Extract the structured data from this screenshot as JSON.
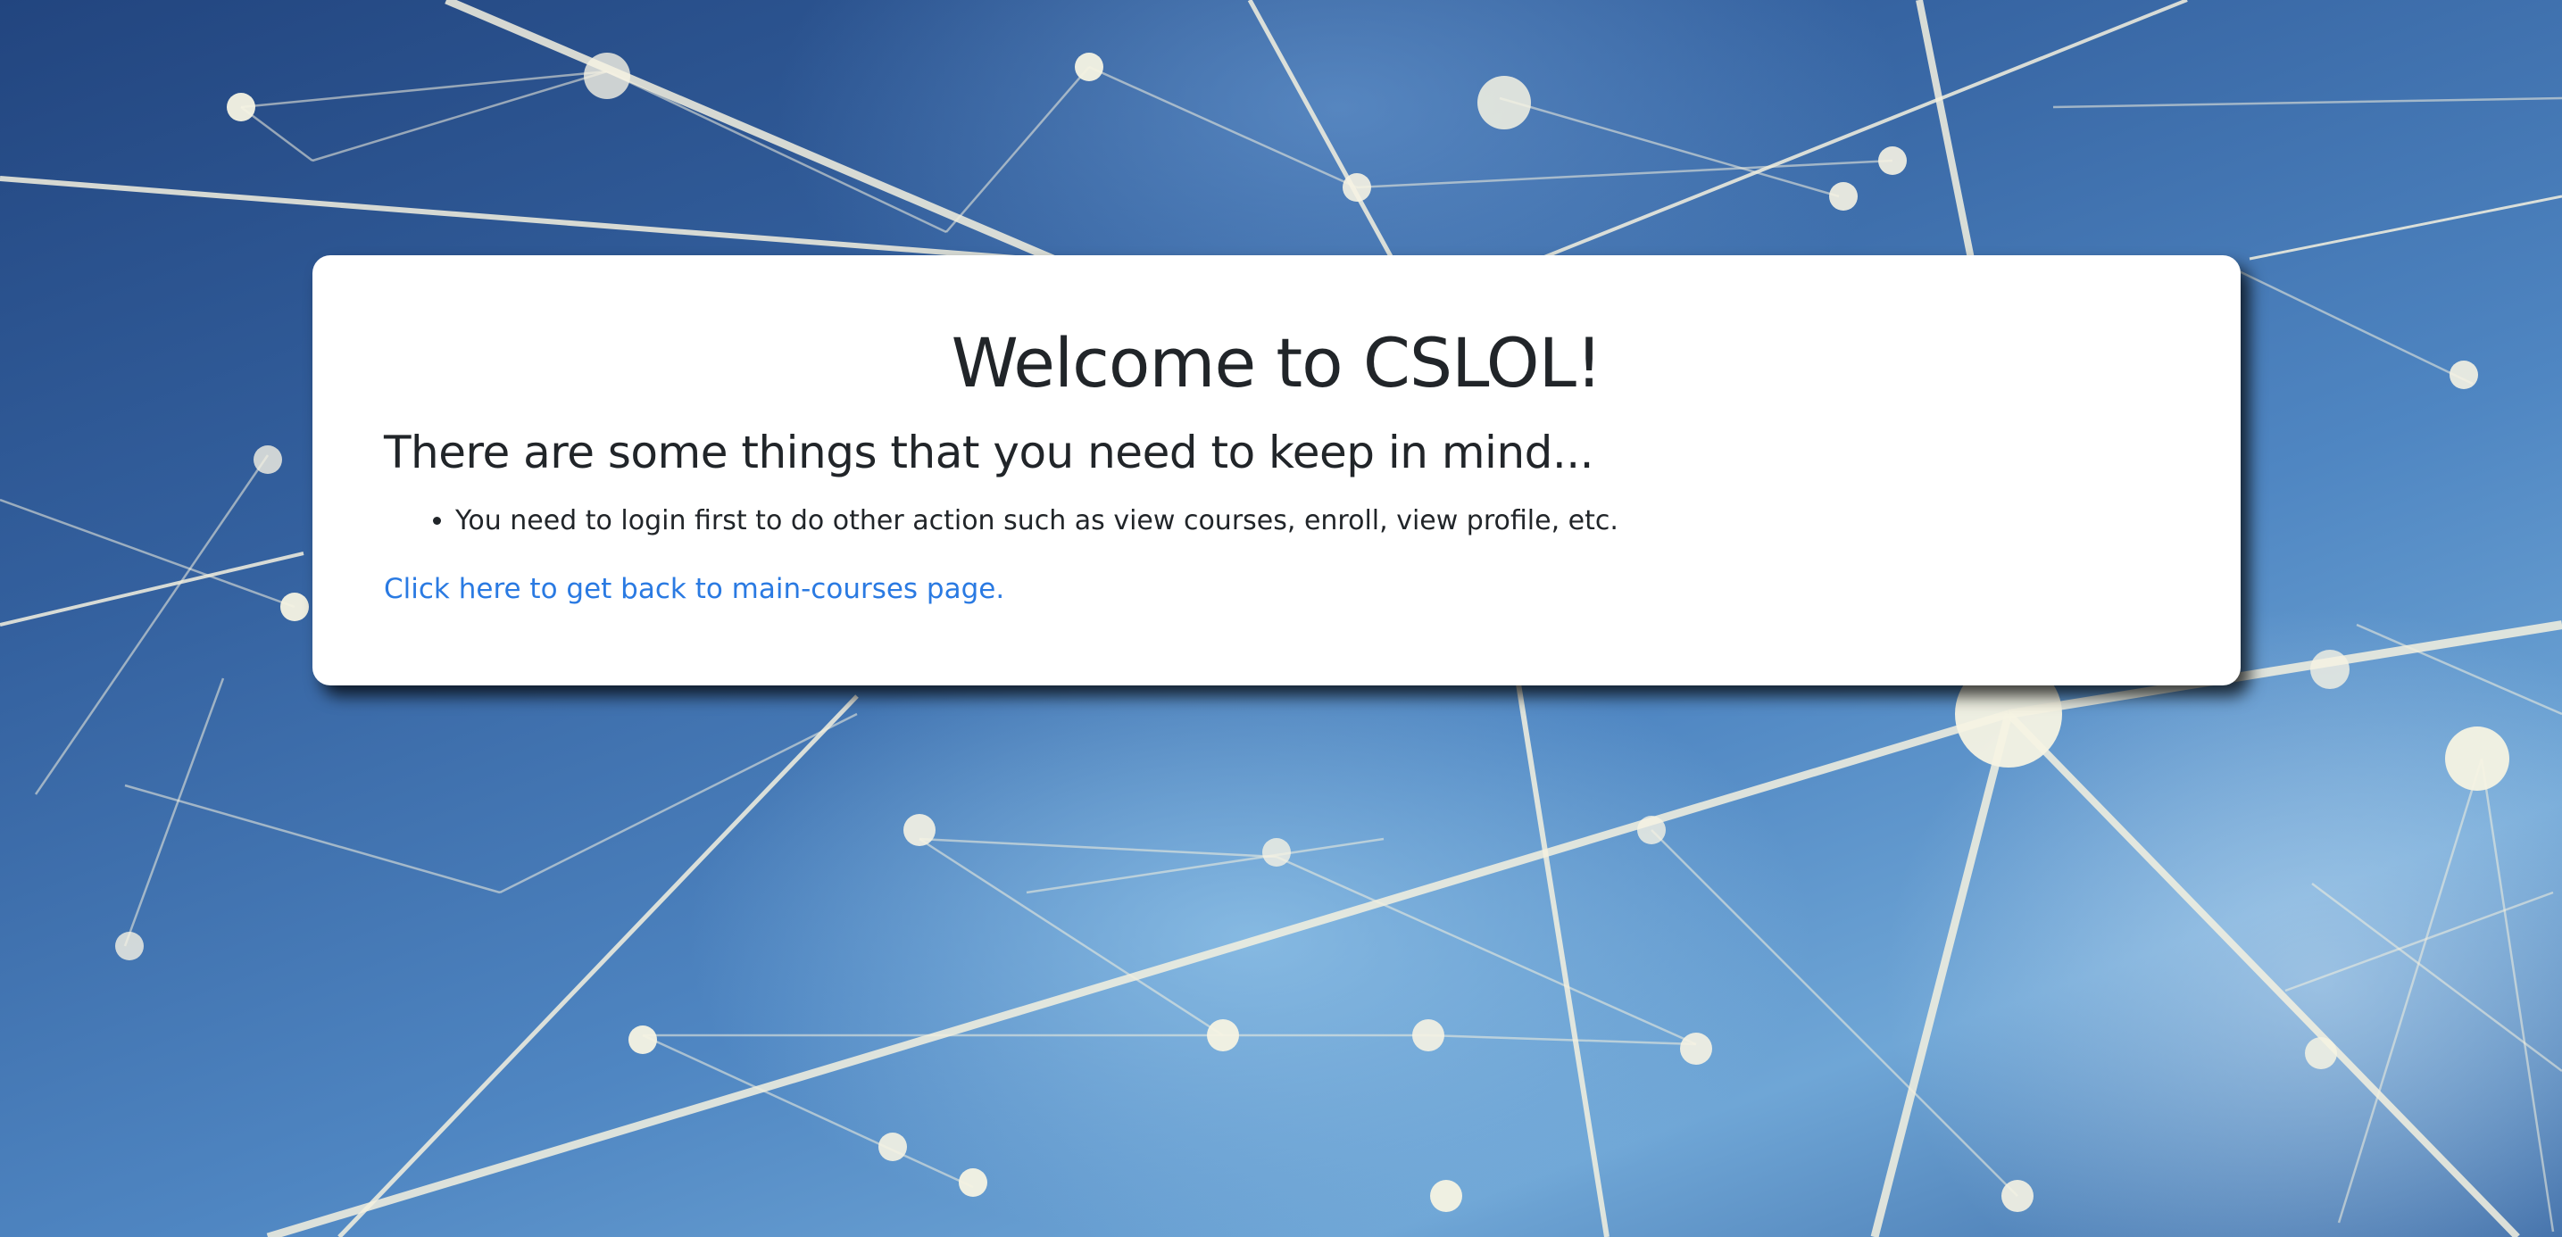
{
  "page": {
    "title": "Welcome to CSLOL!",
    "subtitle": "There are some things that you need to keep in mind...",
    "notes": [
      "You need to login first to do other action such as view courses, enroll, view profile, etc."
    ],
    "back_link": "Click here to get back to main-courses page."
  },
  "colors": {
    "link": "#2a7ae2",
    "text": "#212529",
    "card": "#ffffff",
    "background": "#3a6aa8"
  }
}
